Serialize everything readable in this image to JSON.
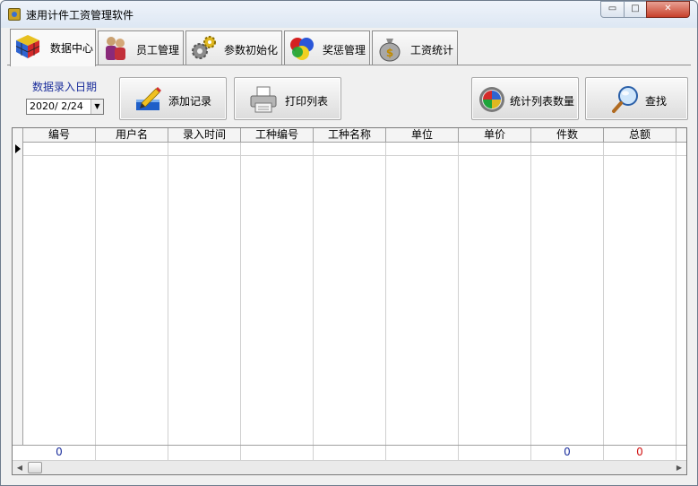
{
  "window": {
    "title": "速用计件工资管理软件",
    "min_glyph": "▭",
    "max_glyph": "□",
    "close_glyph": "✕"
  },
  "tabs": [
    {
      "label": "数据中心",
      "icon": "rubik-cube-icon",
      "active": true
    },
    {
      "label": "员工管理",
      "icon": "users-icon",
      "active": false
    },
    {
      "label": "参数初始化",
      "icon": "gears-icon",
      "active": false
    },
    {
      "label": "奖惩管理",
      "icon": "colored-circles-icon",
      "active": false
    },
    {
      "label": "工资统计",
      "icon": "money-bag-icon",
      "active": false
    }
  ],
  "date": {
    "label": "数据录入日期",
    "value": "2020/ 2/24",
    "arrow": "▼"
  },
  "toolbar": {
    "add_label": "添加记录",
    "print_label": "打印列表",
    "stats_label": "统计列表数量",
    "search_label": "查找"
  },
  "grid": {
    "columns": [
      "编号",
      "用户名",
      "录入时间",
      "工种编号",
      "工种名称",
      "单位",
      "单价",
      "件数",
      "总额"
    ],
    "footer": {
      "col0": "0",
      "col7": "0",
      "col8": "0"
    },
    "footer_colors": {
      "col0": "#1b2e9c",
      "col7": "#1b2e9c",
      "col8": "#d01010"
    },
    "scroll_left": "◀",
    "scroll_right": "▶"
  }
}
